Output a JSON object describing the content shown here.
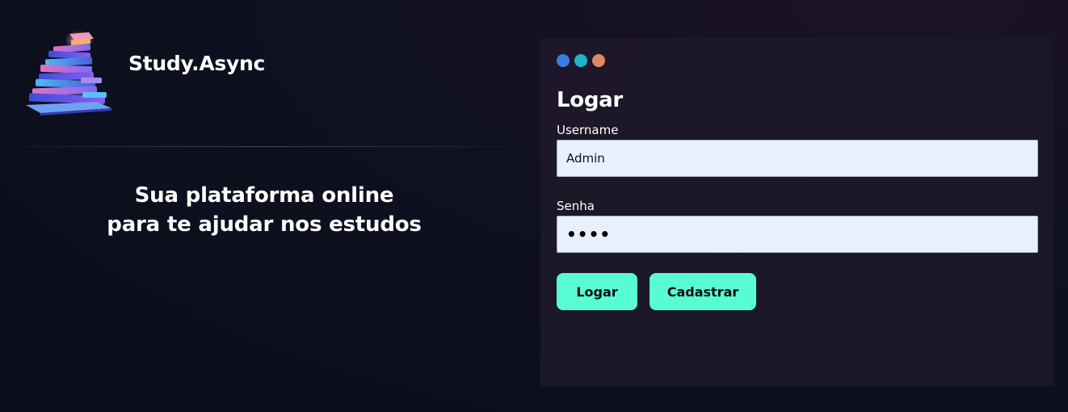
{
  "brand": {
    "name": "Study.Async",
    "logo_icon": "book-stack-icon"
  },
  "tagline": {
    "line1": "Sua plataforma online",
    "line2": "para te ajudar nos estudos"
  },
  "window_dots": {
    "colors": [
      "#3f7be8",
      "#1eb5c9",
      "#e0876a"
    ]
  },
  "login": {
    "title": "Logar",
    "username_label": "Username",
    "username_value": "Admin",
    "password_label": "Senha",
    "password_value": "••••",
    "login_button": "Logar",
    "register_button": "Cadastrar"
  },
  "colors": {
    "accent": "#57fcd4",
    "input_bg": "#e8f0fe",
    "card_bg": "#1c1727",
    "page_bg": "#0c0f1c"
  }
}
